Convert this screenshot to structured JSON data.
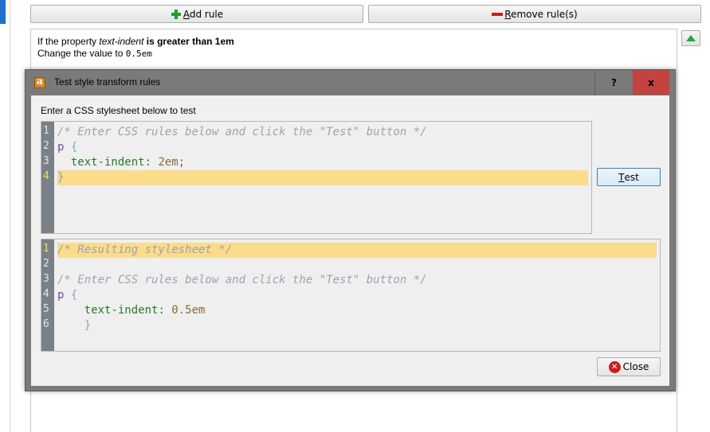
{
  "toolbar": {
    "add_rule": "Add rule",
    "add_rule_accel": "A",
    "add_rule_rest": "dd rule",
    "remove_rule_accel": "R",
    "remove_rule_rest": "emove rule(s)"
  },
  "rule": {
    "line1_prefix": "If the property ",
    "line1_prop": "text-indent",
    "line1_cond": " is greater than 1em",
    "line2_prefix": "Change the value to ",
    "line2_value": "0.5em"
  },
  "dialog": {
    "title": "Test style transform rules",
    "help": "?",
    "close_x": "x",
    "prompt": "Enter a CSS stylesheet below to test",
    "test_accel": "T",
    "test_rest": "est",
    "close_label": "Close"
  },
  "input_editor": {
    "line_numbers": [
      "1",
      "2",
      "3",
      "4"
    ],
    "active_line": "4",
    "l1": "/* Enter CSS rules below and click the \"Test\" button */",
    "l2_sel": "p",
    "l2_brace": " {",
    "l3_prop": "  text-indent",
    "l3_colon": ": ",
    "l3_val": "2em",
    "l3_semi": ";",
    "l4": "}"
  },
  "output_editor": {
    "line_numbers": [
      "1",
      "2",
      "3",
      "4",
      "5",
      "6"
    ],
    "active_line": "1",
    "l1": "/* Resulting stylesheet */",
    "l3": "/* Enter CSS rules below and click the \"Test\" button */",
    "l4_sel": "p",
    "l4_brace": " {",
    "l5_prop": "    text-indent",
    "l5_colon": ": ",
    "l5_val": "0.5em",
    "l6": "    }"
  },
  "colors": {
    "accent": "#1e6fd0",
    "highlight": "#fbdc8a",
    "close_red": "#c2433f"
  }
}
